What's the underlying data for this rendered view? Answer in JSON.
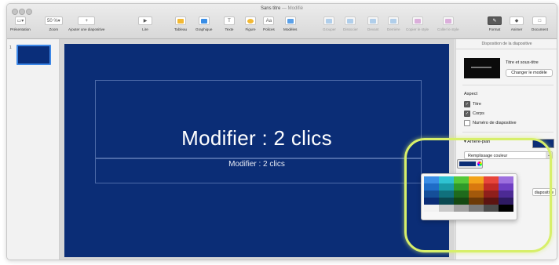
{
  "window": {
    "title": "Sans titre",
    "edited": "— Modifié"
  },
  "toolbar": {
    "items": [
      {
        "id": "presentation",
        "label": "Présentation",
        "glyph": "▭▾"
      },
      {
        "id": "zoom",
        "label": "Zoom",
        "glyph": "50 %▾"
      },
      {
        "id": "add-slide",
        "label": "Ajouter une diapositive",
        "glyph": "+"
      },
      {
        "id": "play",
        "label": "Lire",
        "glyph": "▶"
      },
      {
        "id": "table",
        "label": "Tableau",
        "glyph": ""
      },
      {
        "id": "chart",
        "label": "Graphique",
        "glyph": ""
      },
      {
        "id": "text",
        "label": "Texte",
        "glyph": "T"
      },
      {
        "id": "shape",
        "label": "Figure",
        "glyph": ""
      },
      {
        "id": "fonts",
        "label": "Polices",
        "glyph": "Aa"
      },
      {
        "id": "media",
        "label": "Modèles",
        "glyph": ""
      },
      {
        "id": "group",
        "label": "Grouper",
        "glyph": ""
      },
      {
        "id": "ungroup",
        "label": "Dissocier",
        "glyph": ""
      },
      {
        "id": "front",
        "label": "Devant",
        "glyph": ""
      },
      {
        "id": "back",
        "label": "Derrière",
        "glyph": ""
      },
      {
        "id": "copy-style",
        "label": "Copier le style",
        "glyph": ""
      },
      {
        "id": "paste-style",
        "label": "Coller le style",
        "glyph": ""
      },
      {
        "id": "format",
        "label": "Format",
        "glyph": ""
      },
      {
        "id": "animate",
        "label": "Animer",
        "glyph": ""
      },
      {
        "id": "document",
        "label": "Document",
        "glyph": ""
      }
    ]
  },
  "navigator": {
    "slide_number": "1"
  },
  "slide": {
    "title": "Modifier : 2 clics",
    "body": "Modifier : 2 clics",
    "background_color": "#0b2d76"
  },
  "inspector": {
    "header": "Disposition de la diapositive",
    "layout_name": "Titre et sous-titre",
    "change_master_button": "Changer le modèle",
    "appearance_label": "Aspect",
    "checkboxes": [
      {
        "label": "Titre",
        "checked": true
      },
      {
        "label": "Corps",
        "checked": true
      },
      {
        "label": "Numéro de diapositive",
        "checked": false
      }
    ],
    "background_label": "Arrière-plan",
    "fill_select": "Remplissage couleur",
    "edit_button_fragment": "diapositive"
  },
  "color_palette": {
    "rows": [
      [
        "#3a8ee6",
        "#2fc2d2",
        "#55c83a",
        "#f3a31a",
        "#e7453a",
        "#9d6fde"
      ],
      [
        "#1f6cc7",
        "#199aa8",
        "#2f9a2a",
        "#d9790f",
        "#c22a25",
        "#6f3fc2"
      ],
      [
        "#154f99",
        "#10707c",
        "#1f6a1c",
        "#a3590b",
        "#8f1f1b",
        "#4c2a94"
      ],
      [
        "#0b2d76",
        "#0a4850",
        "#144812",
        "#6d3a07",
        "#5c1411",
        "#2e1a62"
      ],
      [
        "#f2f2f2",
        "#c9c9c9",
        "#a2a2a2",
        "#7a7a7a",
        "#4c4c4c",
        "#000000"
      ]
    ]
  },
  "annotation": {
    "highlight_color": "#d7ef6a"
  }
}
